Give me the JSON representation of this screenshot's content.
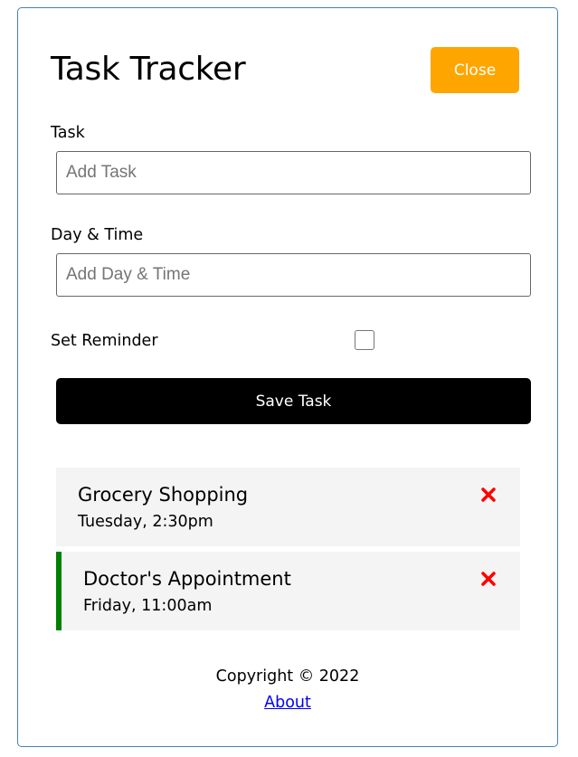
{
  "header": {
    "title": "Task Tracker",
    "close_label": "Close"
  },
  "form": {
    "task_label": "Task",
    "task_placeholder": "Add Task",
    "task_value": "",
    "day_label": "Day & Time",
    "day_placeholder": "Add Day & Time",
    "day_value": "",
    "reminder_label": "Set Reminder",
    "reminder_checked": false,
    "save_label": "Save Task"
  },
  "tasks": [
    {
      "name": "Grocery Shopping",
      "time": "Tuesday, 2:30pm",
      "reminder": false
    },
    {
      "name": "Doctor's Appointment",
      "time": "Friday, 11:00am",
      "reminder": true
    }
  ],
  "footer": {
    "copyright": "Copyright © 2022",
    "about_label": "About"
  },
  "colors": {
    "close_button": "#ffa500",
    "save_button": "#000000",
    "delete_icon": "#ff0000",
    "reminder_border": "#008000",
    "task_background": "#f4f4f4",
    "container_border": "#4682b4"
  },
  "icons": {
    "delete": "times-icon"
  }
}
